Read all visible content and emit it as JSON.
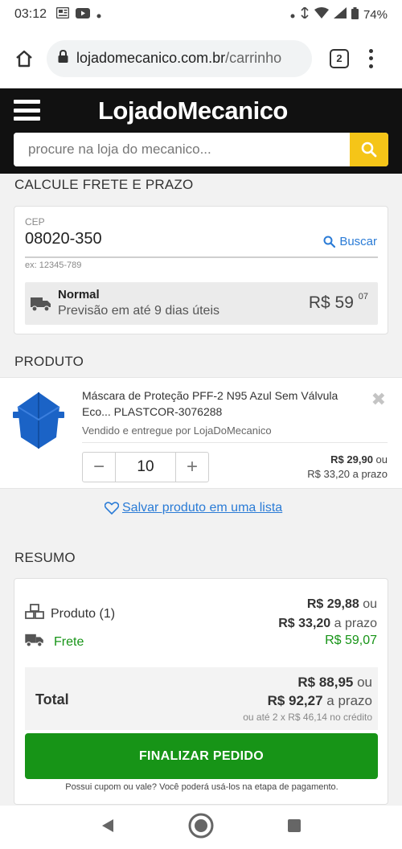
{
  "status_bar": {
    "time": "03:12",
    "battery": "74%"
  },
  "browser": {
    "url_domain": "lojadomecanico.com.br",
    "url_path": "/carrinho",
    "tab_count": "2"
  },
  "store": {
    "logo": "LojadoMecanico",
    "search_placeholder": "procure na loja do mecanico..."
  },
  "frete": {
    "section_title": "CALCULE FRETE E PRAZO",
    "cep_label": "CEP",
    "cep_value": "08020-350",
    "buscar_label": "Buscar",
    "cep_hint": "ex: 12345-789",
    "option": {
      "name": "Normal",
      "eta": "Previsão em até 9 dias úteis",
      "price_main": "R$ 59",
      "price_cents": "07"
    }
  },
  "produto": {
    "section_title": "PRODUTO",
    "name": "Máscara de Proteção PFF-2 N95 Azul Sem Válvula Eco... PLASTCOR-3076288",
    "seller": "Vendido e entregue por LojaDoMecanico",
    "quantity": "10",
    "price_cash": "R$ 29,90",
    "price_cash_suffix": " ou",
    "price_installment": "R$ 33,20 a prazo",
    "save_list_label": "Salvar produto em uma lista"
  },
  "resumo": {
    "section_title": "RESUMO",
    "produto_label": "Produto (1)",
    "produto_cash": "R$ 29,88",
    "produto_cash_suffix": " ou",
    "produto_installment": "R$ 33,20",
    "produto_installment_suffix": " a prazo",
    "frete_label": "Frete",
    "frete_value": "R$ 59,07",
    "total_label": "Total",
    "total_cash": "R$ 88,95",
    "total_cash_suffix": " ou",
    "total_installment": "R$ 92,27",
    "total_installment_suffix": " a prazo",
    "total_credit": "ou até 2 x R$ 46,14 no crédito",
    "finalizar_label": "FINALIZAR PEDIDO",
    "coupon_note": "Possui cupom ou vale? Você poderá usá-los na etapa de pagamento."
  },
  "colors": {
    "accent_green": "#179417",
    "link_blue": "#2a7bd6",
    "search_yellow": "#f5c518",
    "header_black": "#111111"
  }
}
